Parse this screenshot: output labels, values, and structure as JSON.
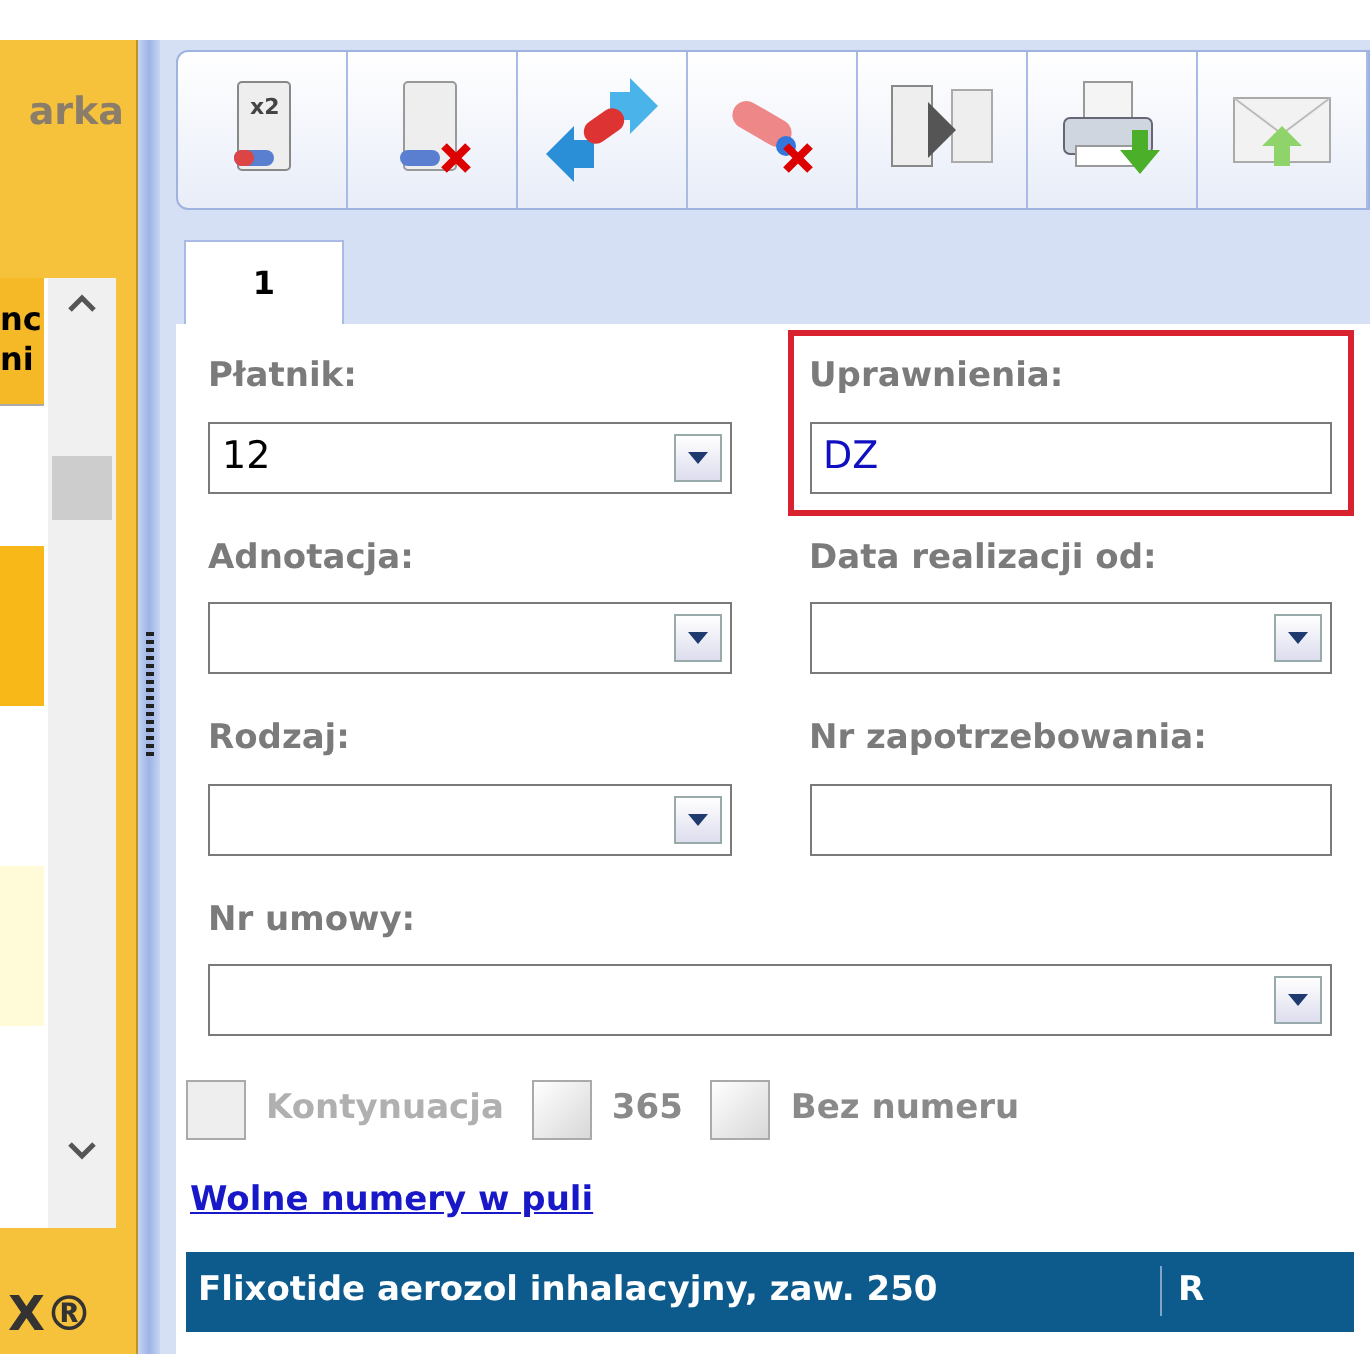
{
  "left_panel": {
    "title": "arka",
    "list_header": [
      "nc",
      "ni"
    ],
    "footer": "X®"
  },
  "toolbar_badge": "x2",
  "tabs": [
    {
      "label": "1",
      "selected": true
    }
  ],
  "field_rows": [
    [
      {
        "label": "Płatnik:",
        "value": "12",
        "kind": "dropdown",
        "highlighted": false
      },
      {
        "label": "Uprawnienia:",
        "value": "DZ",
        "kind": "text",
        "highlighted": true
      }
    ],
    [
      {
        "label": "Adnotacja:",
        "kind": "dropdown",
        "highlighted": false
      },
      {
        "label": "Data realizacji od:",
        "kind": "dropdown",
        "highlighted": false
      }
    ],
    [
      {
        "label": "Rodzaj:",
        "kind": "dropdown",
        "highlighted": false
      },
      {
        "label": "Nr zapotrzebowania:",
        "kind": "text",
        "highlighted": false
      }
    ],
    [
      {
        "label": "Nr umowy:",
        "kind": "dropdown",
        "highlighted": false
      }
    ]
  ],
  "checkboxes": [
    {
      "label": "Kontynuacja",
      "checked": false,
      "disabled": true
    },
    {
      "label": "365",
      "checked": false,
      "disabled": false
    },
    {
      "label": "Bez numeru",
      "checked": false,
      "disabled": false
    }
  ],
  "link": "Wolne numery w puli",
  "table": {
    "columns": [
      "Flixotide aerozol inhalacyjny, zaw. 250",
      "R"
    ]
  }
}
